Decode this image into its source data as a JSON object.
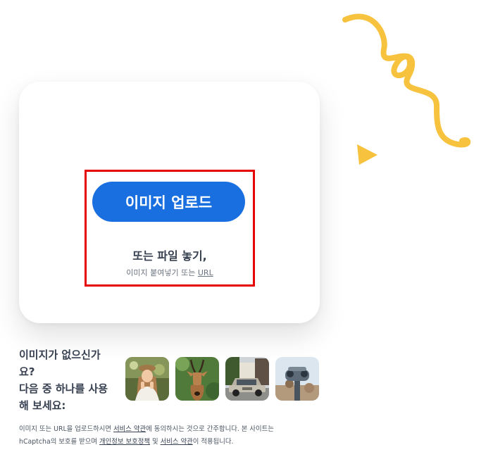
{
  "upload": {
    "button_label": "이미지 업로드",
    "drop_title": "또는 파일 놓기,",
    "drop_sub_prefix": "이미지 붙여넣기 또는 ",
    "url_link": "URL"
  },
  "samples": {
    "prompt_line1": "이미지가 없으신가",
    "prompt_line2": "요?",
    "prompt_line3": "다음 중 하나를 사용",
    "prompt_line4": "해 보세요:",
    "items": [
      {
        "subject": "woman-photo"
      },
      {
        "subject": "antelope-photo"
      },
      {
        "subject": "car-photo"
      },
      {
        "subject": "binoculars-photo"
      }
    ]
  },
  "legal": {
    "p1": "이미지 또는 URL을 업로드하시면 ",
    "terms1": "서비스 약관",
    "p2": "에 동의하시는 것으로 간주합니다. 본 사이트는",
    "p3": "hCaptcha의 보호를 받으며 ",
    "privacy": "개인정보 보호정책",
    "p4": " 및 ",
    "terms2": "서비스 약관",
    "p5": "이 적용됩니다."
  },
  "colors": {
    "accent": "#1a6fe0",
    "decor": "#f7c23e",
    "highlight": "#e60000"
  }
}
